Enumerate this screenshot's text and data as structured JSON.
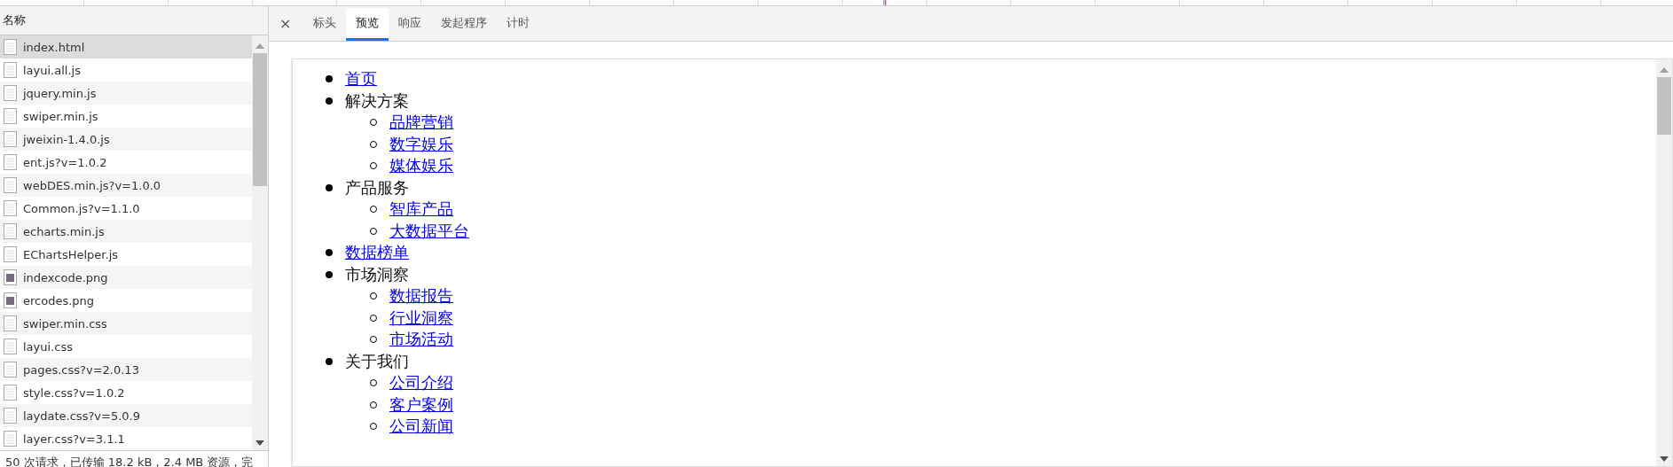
{
  "requests": {
    "header": "名称",
    "rows": [
      {
        "name": "index.html",
        "kind": "doc",
        "selected": true
      },
      {
        "name": "layui.all.js",
        "kind": "doc",
        "selected": false
      },
      {
        "name": "jquery.min.js",
        "kind": "doc",
        "selected": false
      },
      {
        "name": "swiper.min.js",
        "kind": "doc",
        "selected": false
      },
      {
        "name": "jweixin-1.4.0.js",
        "kind": "doc",
        "selected": false
      },
      {
        "name": "ent.js?v=1.0.2",
        "kind": "doc",
        "selected": false
      },
      {
        "name": "webDES.min.js?v=1.0.0",
        "kind": "doc",
        "selected": false
      },
      {
        "name": "Common.js?v=1.1.0",
        "kind": "doc",
        "selected": false
      },
      {
        "name": "echarts.min.js",
        "kind": "doc",
        "selected": false
      },
      {
        "name": "EChartsHelper.js",
        "kind": "doc",
        "selected": false
      },
      {
        "name": "indexcode.png",
        "kind": "image",
        "selected": false
      },
      {
        "name": "ercodes.png",
        "kind": "image",
        "selected": false
      },
      {
        "name": "swiper.min.css",
        "kind": "doc",
        "selected": false
      },
      {
        "name": "layui.css",
        "kind": "doc",
        "selected": false
      },
      {
        "name": "pages.css?v=2.0.13",
        "kind": "doc",
        "selected": false
      },
      {
        "name": "style.css?v=1.0.2",
        "kind": "doc",
        "selected": false
      },
      {
        "name": "laydate.css?v=5.0.9",
        "kind": "doc",
        "selected": false
      },
      {
        "name": "layer.css?v=3.1.1",
        "kind": "doc",
        "selected": false
      }
    ],
    "status": "50 次请求，已传输 18.2 kB，2.4 MB 资源，完"
  },
  "detail": {
    "close": "×",
    "tabs": [
      {
        "label": "标头",
        "selected": false
      },
      {
        "label": "预览",
        "selected": true
      },
      {
        "label": "响应",
        "selected": false
      },
      {
        "label": "发起程序",
        "selected": false
      },
      {
        "label": "计时",
        "selected": false
      }
    ],
    "preview": [
      {
        "label": "首页",
        "link": true
      },
      {
        "label": "解决方案",
        "link": false,
        "children": [
          {
            "label": "品牌营销",
            "link": true
          },
          {
            "label": "数字娱乐",
            "link": true
          },
          {
            "label": "媒体娱乐",
            "link": true
          }
        ]
      },
      {
        "label": "产品服务",
        "link": false,
        "children": [
          {
            "label": "智库产品",
            "link": true
          },
          {
            "label": "大数据平台",
            "link": true
          }
        ]
      },
      {
        "label": "数据榜单",
        "link": true
      },
      {
        "label": "市场洞察",
        "link": false,
        "children": [
          {
            "label": "数据报告",
            "link": true
          },
          {
            "label": "行业洞察",
            "link": true
          },
          {
            "label": "市场活动",
            "link": true
          }
        ]
      },
      {
        "label": "关于我们",
        "link": false,
        "children": [
          {
            "label": "公司介绍",
            "link": true
          },
          {
            "label": "客户案例",
            "link": true
          },
          {
            "label": "公司新闻",
            "link": true
          }
        ]
      }
    ]
  }
}
